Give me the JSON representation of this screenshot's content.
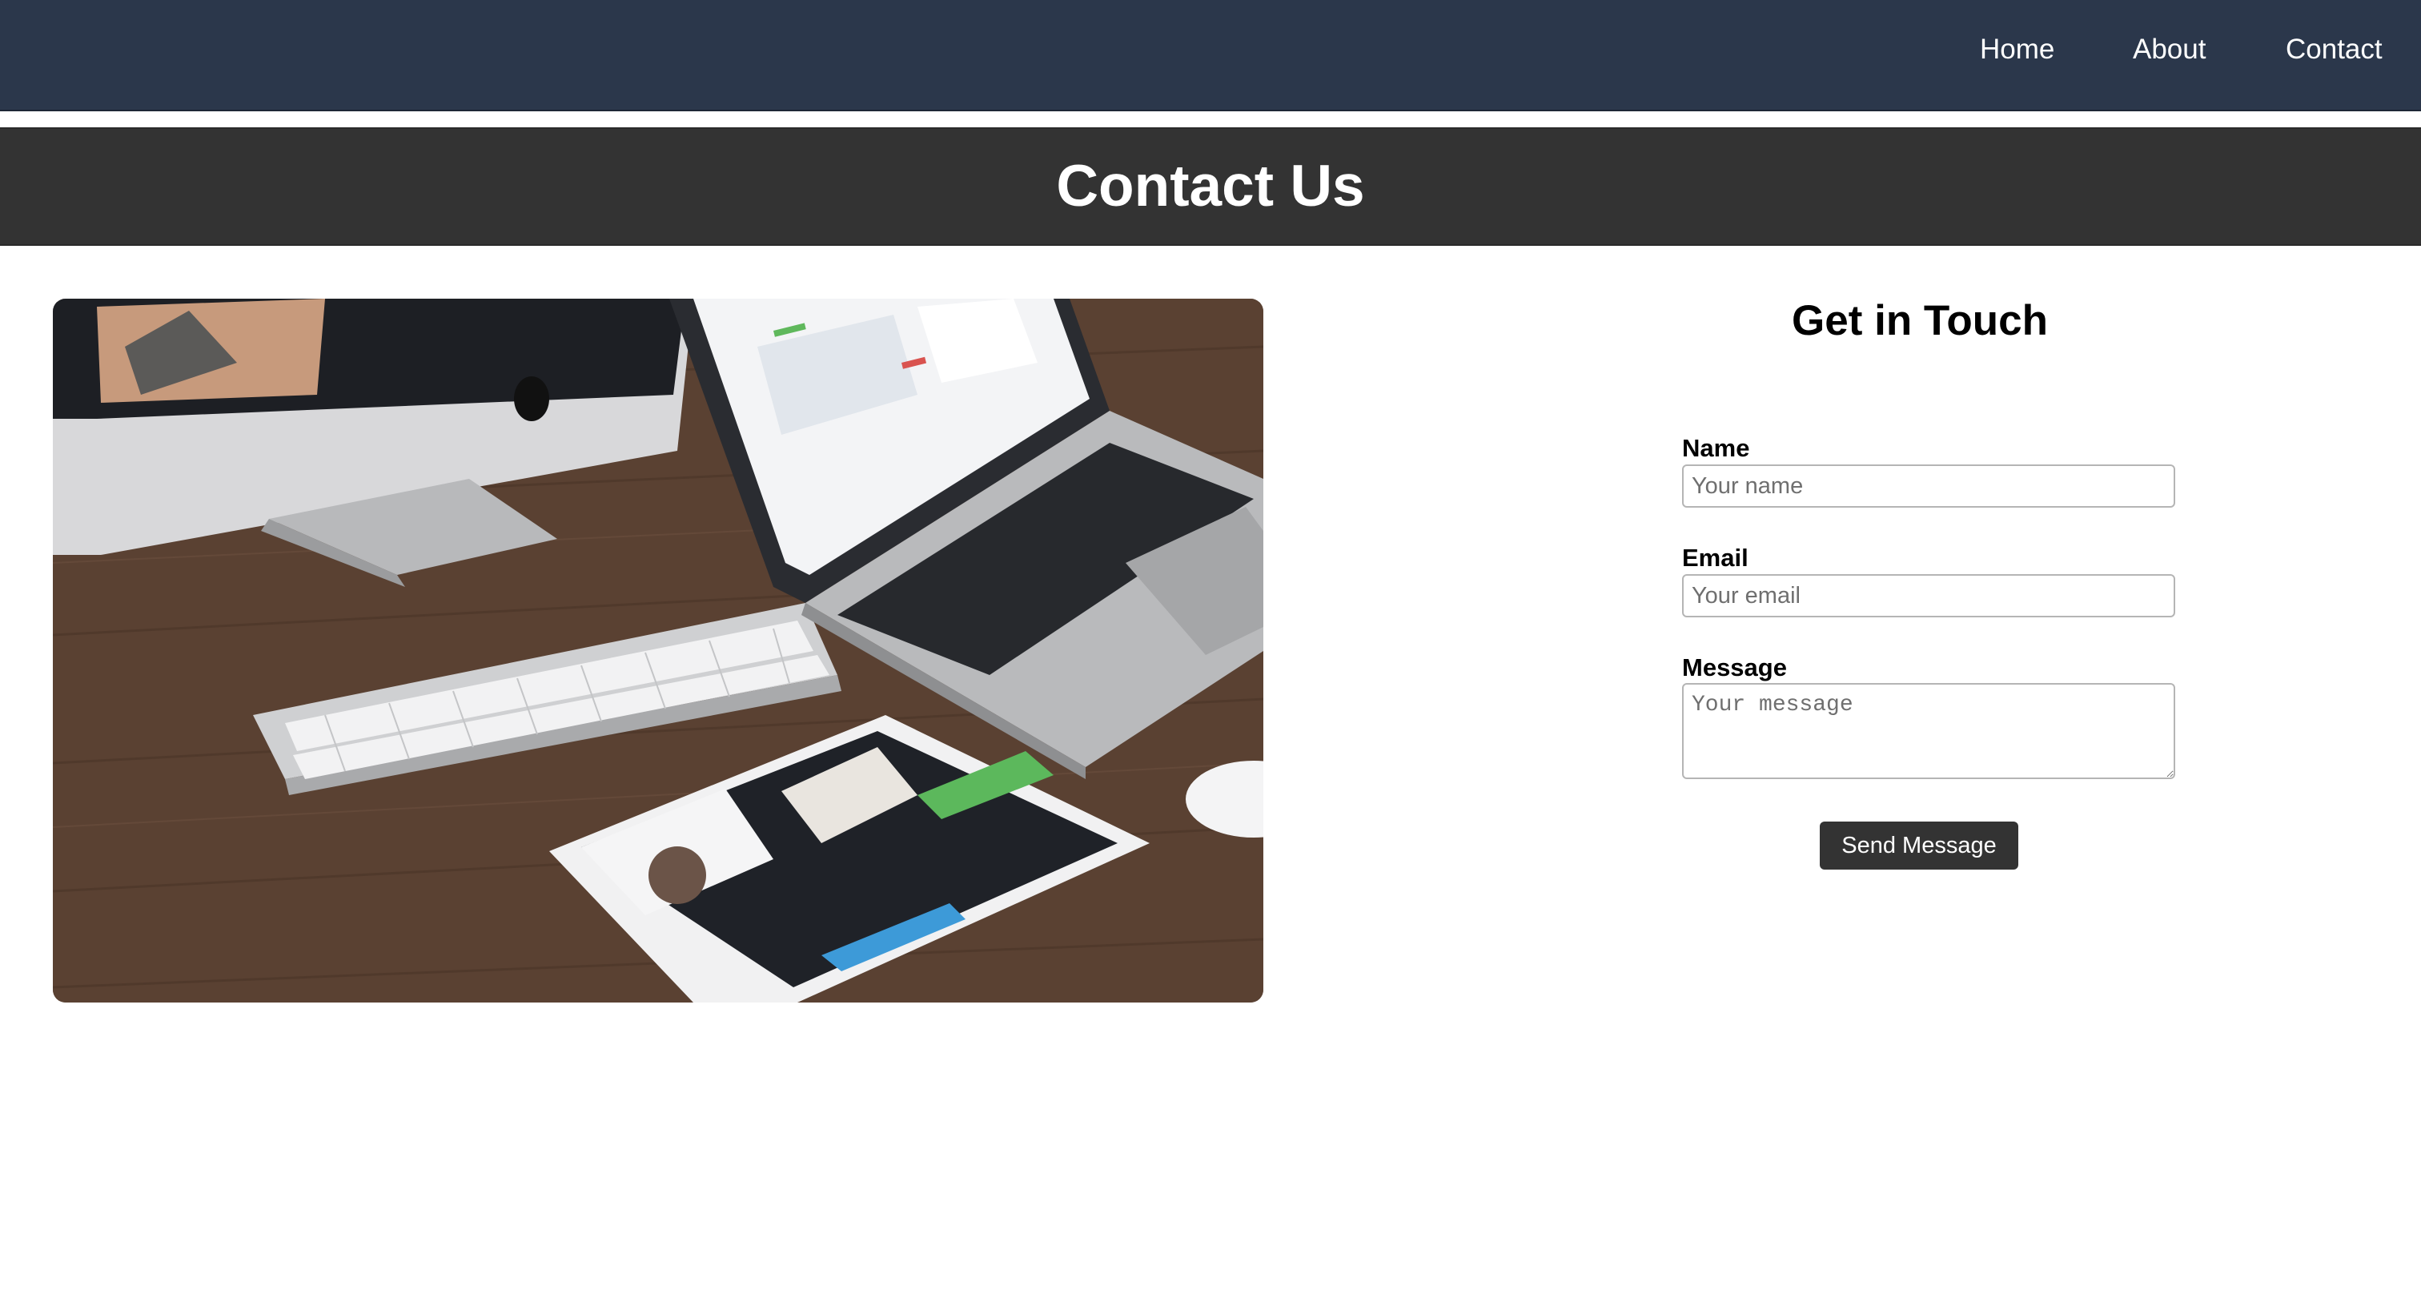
{
  "nav": {
    "home": "Home",
    "about": "About",
    "contact": "Contact"
  },
  "header": {
    "title": "Contact Us"
  },
  "form": {
    "title": "Get in Touch",
    "name_label": "Name",
    "name_placeholder": "Your name",
    "email_label": "Email",
    "email_placeholder": "Your email",
    "message_label": "Message",
    "message_placeholder": "Your message",
    "submit_label": "Send Message"
  },
  "image": {
    "subject": "desk-with-imac-macbook-ipad-keyboard"
  },
  "colors": {
    "navbar_bg": "#2b374b",
    "header_bg": "#333333",
    "button_bg": "#333333"
  }
}
